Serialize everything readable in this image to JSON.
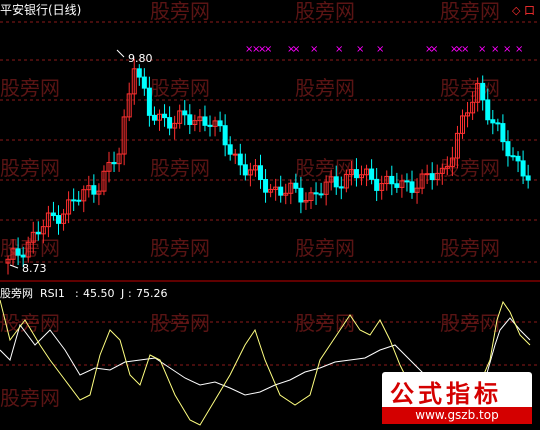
{
  "chart_data": [
    {
      "type": "candlestick",
      "title": "平安银行(日线)",
      "markers": {
        "high_label": "9.80",
        "low_label": "8.73"
      },
      "signal_glyph": "×",
      "colors": {
        "up": "#ff3030",
        "down": "#00ffff",
        "signal": "#ff00ff",
        "grid": "#8b1a1a",
        "axis": "#c00000"
      }
    },
    {
      "type": "line",
      "indicator_label": "股旁网",
      "series": [
        {
          "name": "RSI1",
          "value_label": "45.50",
          "color": "#ffffff"
        },
        {
          "name": "J",
          "value_label": "75.26",
          "color": "#ffff80"
        }
      ]
    }
  ],
  "watermarks": [
    "股旁网",
    "股旁网",
    "股旁网",
    "股旁网",
    "股旁网",
    "股旁网",
    "股旁网",
    "股旁网",
    "股旁网",
    "股旁网",
    "股旁网",
    "股旁网",
    "股旁网",
    "股旁网",
    "股旁网",
    "股旁网",
    "股旁网",
    "股旁网",
    "股旁网",
    "股旁网"
  ],
  "corner_glyph": "◇ 口",
  "badge": {
    "title": "公式指标",
    "url": "www.gszb.top"
  }
}
